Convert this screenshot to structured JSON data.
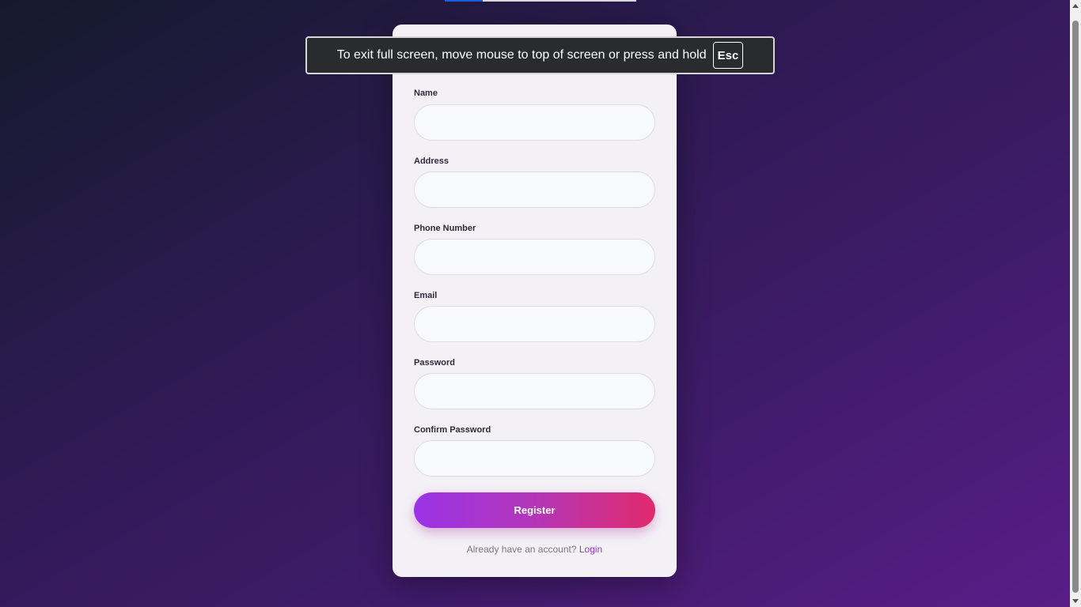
{
  "fullscreen_notice": {
    "message": "To exit full screen, move mouse to top of screen or press and hold",
    "key": "Esc"
  },
  "form": {
    "fields": [
      {
        "label": "Name",
        "value": "",
        "placeholder": ""
      },
      {
        "label": "Address",
        "value": "",
        "placeholder": ""
      },
      {
        "label": "Phone Number",
        "value": "",
        "placeholder": ""
      },
      {
        "label": "Email",
        "value": "",
        "placeholder": ""
      },
      {
        "label": "Password",
        "value": "",
        "placeholder": ""
      },
      {
        "label": "Confirm Password",
        "value": "",
        "placeholder": ""
      }
    ],
    "submit_label": "Register",
    "login_prompt": "Already have an account?",
    "login_link": "Login"
  },
  "colors": {
    "button_gradient_start": "#9a34e6",
    "button_gradient_end": "#e02a6c",
    "link": "#9b35d9",
    "card_background": "#f3f1f6"
  }
}
